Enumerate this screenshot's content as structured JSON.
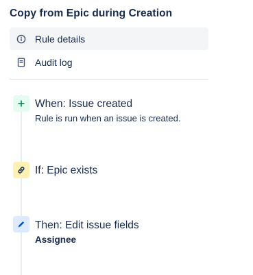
{
  "rule": {
    "title": "Copy from Epic during Creation"
  },
  "nav": {
    "items": [
      {
        "label": "Rule details",
        "icon": "info-icon",
        "active": true
      },
      {
        "label": "Audit log",
        "icon": "document-icon",
        "active": false
      }
    ]
  },
  "steps": [
    {
      "kind": "trigger",
      "icon": "plus-icon",
      "title": "When: Issue created",
      "description": "Rule is run when an issue is created."
    },
    {
      "kind": "condition",
      "icon": "link-icon",
      "title": "If: Epic exists"
    },
    {
      "kind": "action",
      "icon": "pencil-icon",
      "title": "Then: Edit issue fields",
      "detail": "Assignee"
    }
  ],
  "colors": {
    "text": "#172b4d",
    "active_nav_bg": "#f4f5f7",
    "trigger_bg": "#e3fcef",
    "trigger_icon": "#00875a",
    "condition_bg": "#fff0b3",
    "condition_icon": "#172b4d",
    "action_bg": "#deebff",
    "action_icon": "#0052cc",
    "rail": "#ebecf0"
  }
}
